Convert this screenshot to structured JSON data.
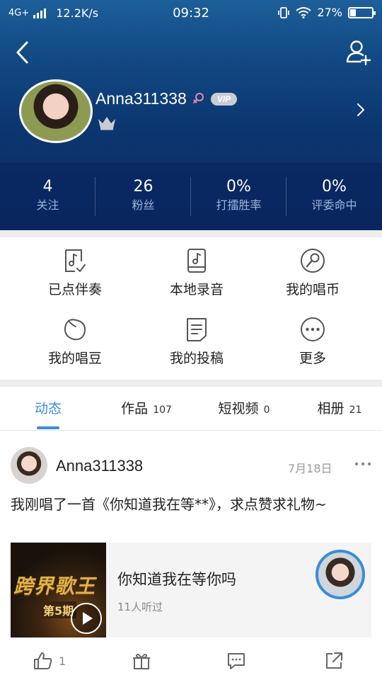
{
  "status_bar": {
    "network": "4G+",
    "speed": "12.2K/s",
    "time": "09:32",
    "battery": "27%",
    "battery_level": 0.27
  },
  "profile": {
    "username": "Anna311338",
    "vip_label": "VIP",
    "stats": [
      {
        "value": "4",
        "label": "关注"
      },
      {
        "value": "26",
        "label": "粉丝"
      },
      {
        "value": "0%",
        "label": "打擂胜率"
      },
      {
        "value": "0%",
        "label": "评委命中"
      }
    ]
  },
  "menu": [
    {
      "label": "已点伴奏",
      "icon": "music-check-icon"
    },
    {
      "label": "本地录音",
      "icon": "phone-music-icon"
    },
    {
      "label": "我的唱币",
      "icon": "mic-coin-icon"
    },
    {
      "label": "我的唱豆",
      "icon": "bean-icon"
    },
    {
      "label": "我的投稿",
      "icon": "document-icon"
    },
    {
      "label": "更多",
      "icon": "more-circle-icon"
    }
  ],
  "tabs": [
    {
      "label": "动态",
      "count": "",
      "active": true
    },
    {
      "label": "作品",
      "count": "107",
      "active": false
    },
    {
      "label": "短视频",
      "count": "0",
      "active": false
    },
    {
      "label": "相册",
      "count": "21",
      "active": false
    }
  ],
  "post": {
    "username": "Anna311338",
    "date": "7月18日",
    "text": "我刚唱了一首《你知道我在等**》，求点赞求礼物~",
    "song": {
      "title": "你知道我在等你吗",
      "listens": "11人听过",
      "cover_title": "跨界歌王",
      "cover_episode": "第5期"
    },
    "actions": {
      "like_count": "1"
    }
  },
  "colors": {
    "accent": "#3b8dd6",
    "header_top": "#1d5f9a",
    "header_bottom": "#0a2a5e"
  }
}
